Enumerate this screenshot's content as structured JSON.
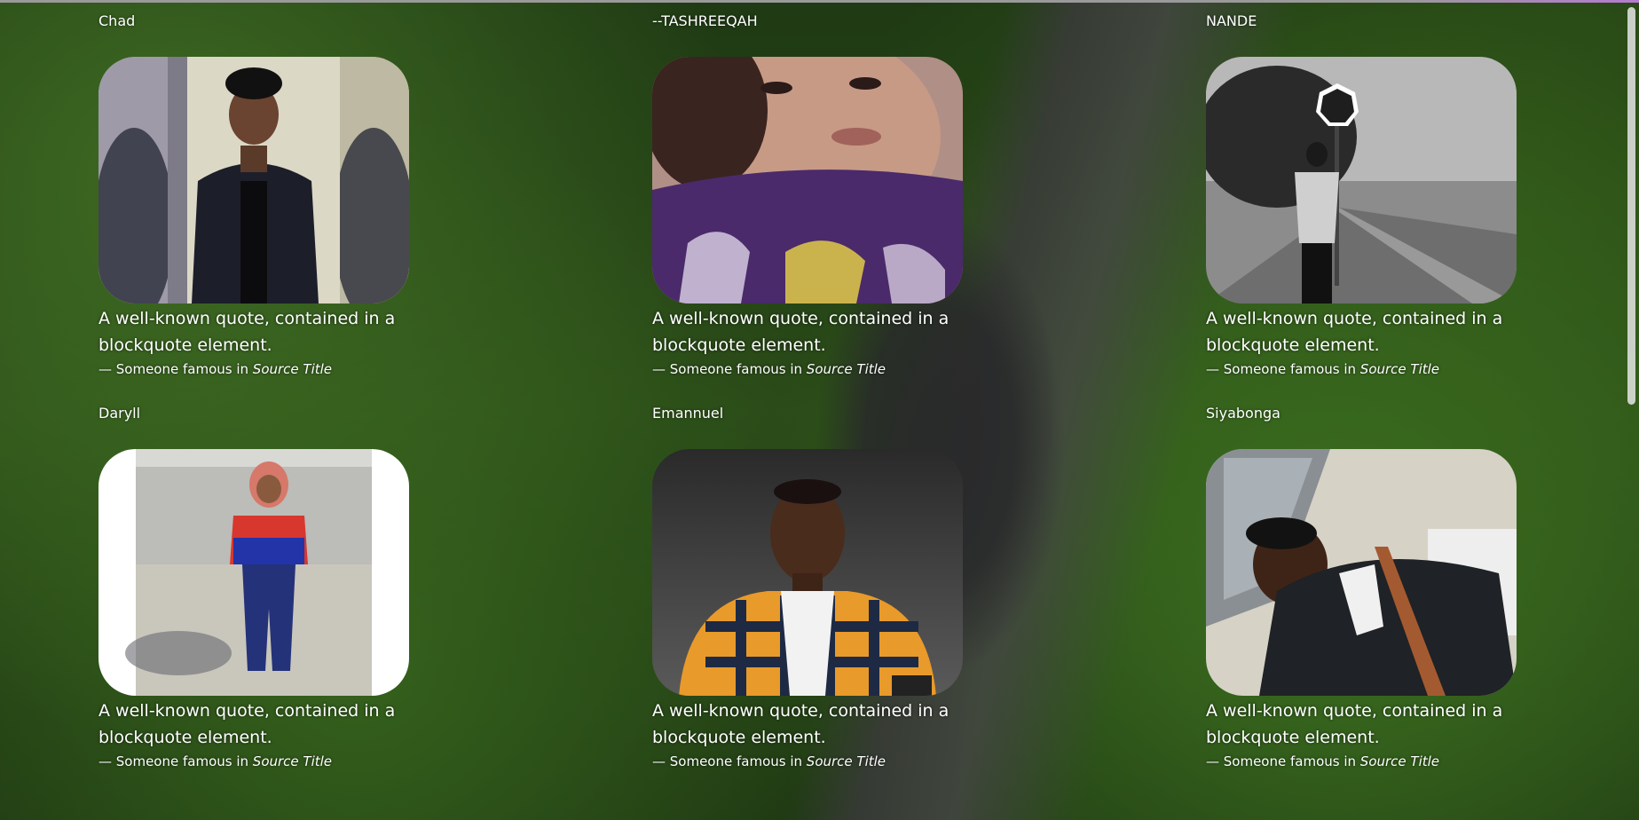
{
  "profiles": [
    {
      "name": "Chad",
      "photo_alt": "Chad portrait",
      "quote": "A well-known quote, contained in a blockquote element.",
      "attribution_prefix": "— Someone famous in",
      "source_title": "Source Title"
    },
    {
      "name": "--TASHREEQAH",
      "photo_alt": "Tashreeqah portrait",
      "quote": "A well-known quote, contained in a blockquote element.",
      "attribution_prefix": "— Someone famous in",
      "source_title": "Source Title"
    },
    {
      "name": "NANDE",
      "photo_alt": "Nande portrait",
      "quote": "A well-known quote, contained in a blockquote element.",
      "attribution_prefix": "— Someone famous in",
      "source_title": "Source Title"
    },
    {
      "name": "Daryll",
      "photo_alt": "Daryll portrait",
      "quote": "A well-known quote, contained in a blockquote element.",
      "attribution_prefix": "— Someone famous in",
      "source_title": "Source Title"
    },
    {
      "name": "Emannuel",
      "photo_alt": "Emannuel portrait",
      "quote": "A well-known quote, contained in a blockquote element.",
      "attribution_prefix": "— Someone famous in",
      "source_title": "Source Title"
    },
    {
      "name": "Siyabonga",
      "photo_alt": "Siyabonga portrait",
      "quote": "A well-known quote, contained in a blockquote element.",
      "attribution_prefix": "— Someone famous in",
      "source_title": "Source Title"
    }
  ]
}
